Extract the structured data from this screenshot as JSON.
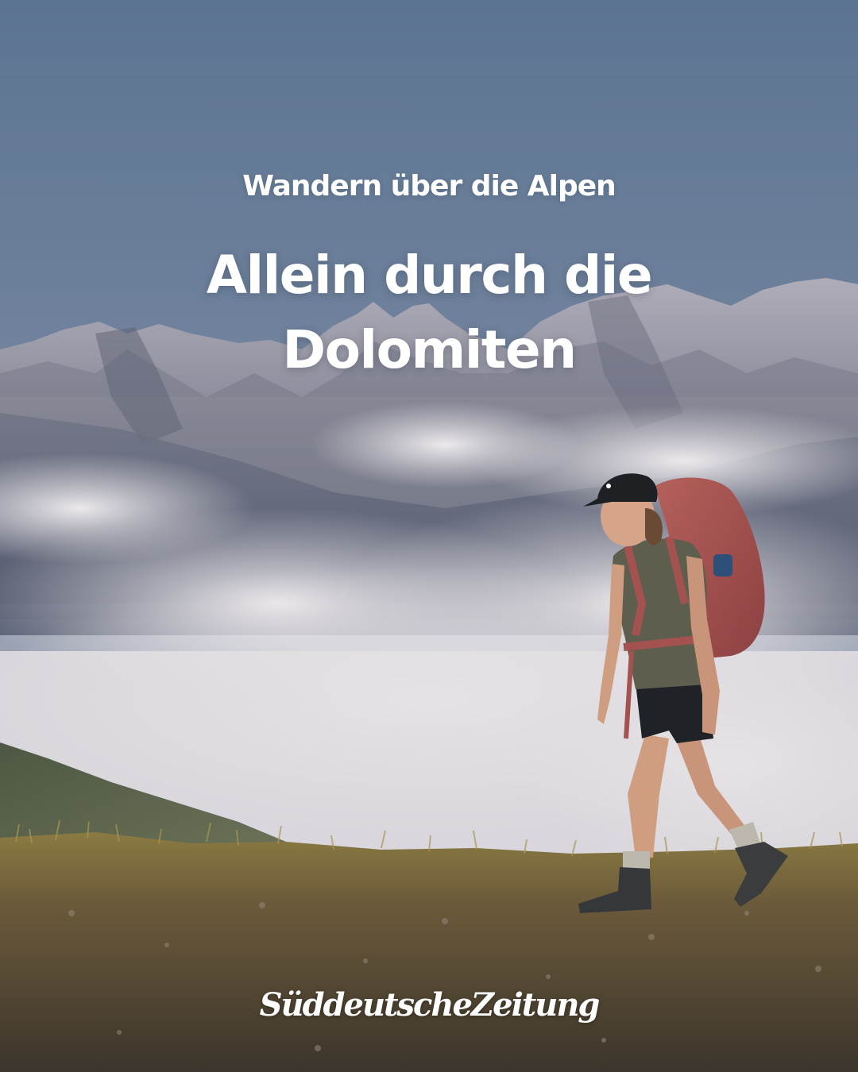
{
  "post": {
    "kicker": "Wandern über die Alpen",
    "headline": "Allein durch die Dolomiten",
    "publisher_logo_text": "SüddeutscheZeitung"
  },
  "colors": {
    "sky_top": "#5f7896",
    "sky_bottom": "#8c97ab",
    "mountain": "#8d8c98",
    "cloud": "#e9e6ea",
    "grass": "#8a7a3f",
    "backpack": "#a4524f",
    "shirt": "#5d5e4d",
    "text": "#ffffff"
  },
  "scene": {
    "subject": "hiker-walking-with-backpack",
    "background": "dolomite-peaks-above-clouds"
  }
}
